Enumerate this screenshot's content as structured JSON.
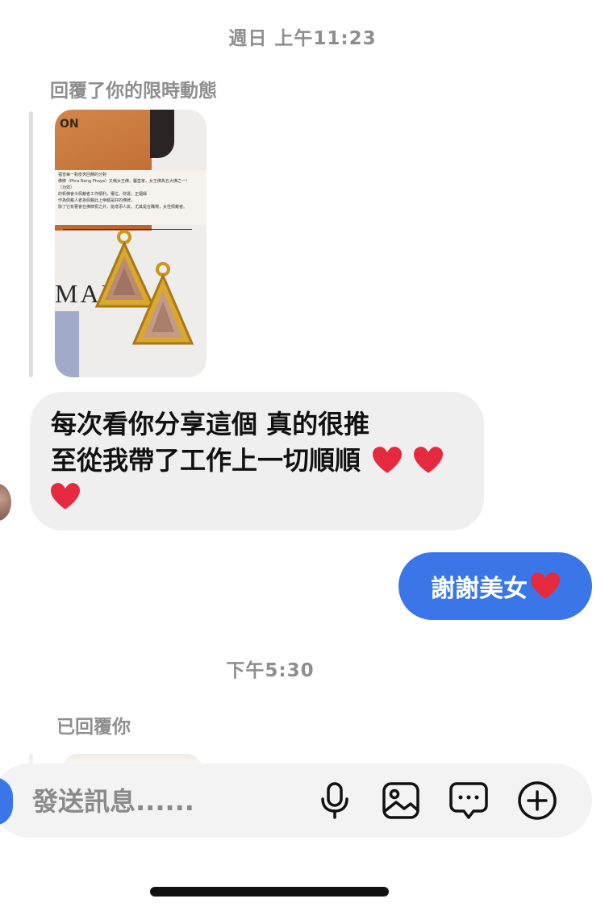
{
  "timestamps": {
    "first": "週日 上午11:23",
    "second": "下午5:30"
  },
  "story_reply": {
    "label": "回覆了你的限時動態",
    "thumbnail": {
      "box_text": "ON",
      "brand_text": "MAIRE",
      "card_lines": [
        "福音每一對皮夾回饋的分對",
        "佛牌（Phra Nang Phaya）又稱女王佛，屬皇家，女王佛為五大佛之一！",
        "（功效）",
        "的帆佛會令佩戴者工作順利，權位，財運，正姻緣",
        "作為佩戴人者為佩戴此上帝都是好的佛牌，",
        "除了它有著會在佛牌祝之外，能增添人氣，尤其是在職場，女性佩戴者。"
      ]
    }
  },
  "received_message": {
    "line1": "每次看你分享這個 真的很推",
    "line2": "至從我帶了工作上一切順順"
  },
  "sent_message": {
    "text": "謝謝美女"
  },
  "second_reply": {
    "label": "已回覆你"
  },
  "composer": {
    "placeholder": "發送訊息......"
  },
  "icons": {
    "mic": "microphone-icon",
    "image": "image-icon",
    "sticker": "chat-bubble-icon",
    "plus": "add-circle-icon",
    "heart": "red-heart-emoji"
  },
  "colors": {
    "sent_bubble": "#3a76e8",
    "received_bubble": "#efefef",
    "heart": "#e5293f",
    "timestamp": "#8e8e8e"
  }
}
